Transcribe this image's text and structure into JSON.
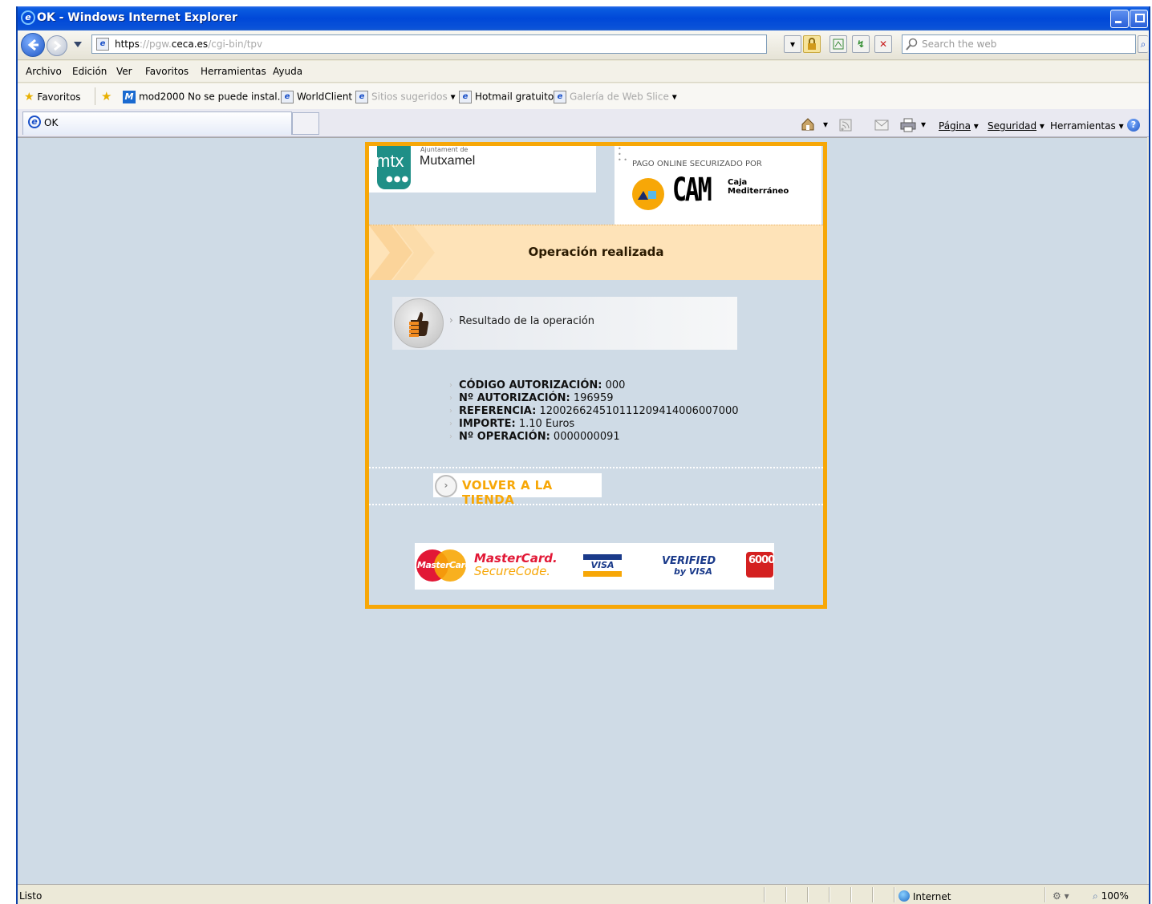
{
  "window": {
    "title": "OK - Windows Internet Explorer"
  },
  "address_bar": {
    "url_scheme": "https",
    "url_sep": "://",
    "url_sub": "pgw.",
    "url_host": "ceca.es",
    "url_path": "/cgi-bin/tpv",
    "search_placeholder": "Search the web"
  },
  "menu": {
    "items": [
      "Archivo",
      "Edición",
      "Ver",
      "Favoritos",
      "Herramientas",
      "Ayuda"
    ]
  },
  "favorites_bar": {
    "favorites_label": "Favoritos",
    "links": [
      "mod2000 No se puede instal...",
      "WorldClient",
      "Sitios sugeridos",
      "Hotmail gratuito",
      "Galería de Web Slice"
    ]
  },
  "tab": {
    "label": "OK"
  },
  "command_bar": {
    "page": "Página",
    "security": "Seguridad",
    "tools": "Herramientas"
  },
  "page": {
    "header": {
      "ajuntament_prefix": "Ajuntament de",
      "town": "Mutxamel",
      "mtx": "mtx",
      "secured_by": "PAGO ONLINE SECURIZADO POR",
      "cam": "CAM",
      "caja_line1": "Caja",
      "caja_line2": "Mediterráneo"
    },
    "banner_title": "Operación realizada",
    "result_label": "Resultado de la operación",
    "details": [
      {
        "label": "CÓDIGO AUTORIZACIÓN:",
        "value": "000"
      },
      {
        "label": "Nº AUTORIZACIÓN:",
        "value": "196959"
      },
      {
        "label": "REFERENCIA:",
        "value": "120026624510111209414006007000"
      },
      {
        "label": "IMPORTE:",
        "value": "1.10 Euros"
      },
      {
        "label": "Nº OPERACIÓN:",
        "value": "0000000091"
      }
    ],
    "back_button": "VOLVER A LA TIENDA",
    "card_logos": {
      "mastercard": "MasterCard",
      "mc_secure_line1": "MasterCard.",
      "mc_secure_line2": "SecureCode.",
      "visa": "VISA",
      "verified_line1": "VERIFIED",
      "verified_line2": "by VISA",
      "6000": "6000"
    }
  },
  "status_bar": {
    "status": "Listo",
    "zone": "Internet",
    "zoom": "100%"
  },
  "colors": {
    "accent_orange": "#f7a707",
    "banner_bg": "#fee3b8",
    "page_bg": "#cfdbe6",
    "titlebar_blue": "#0048d8"
  }
}
